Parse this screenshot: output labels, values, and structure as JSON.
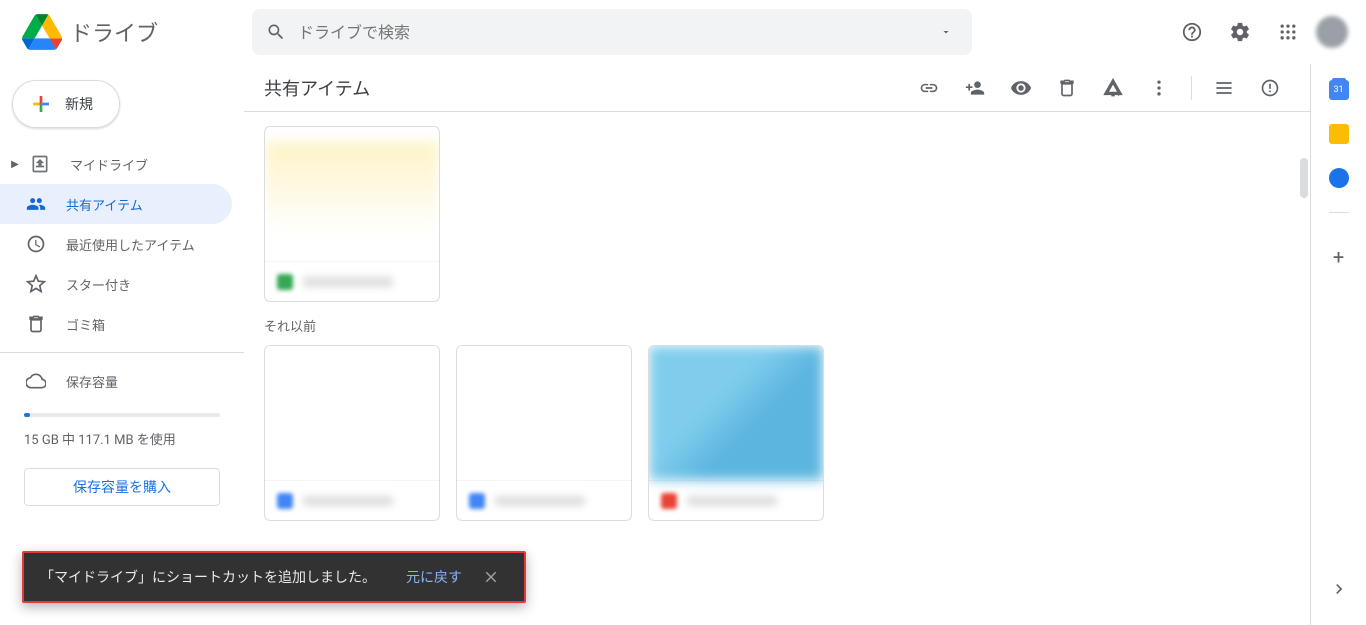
{
  "app_name": "ドライブ",
  "search": {
    "placeholder": "ドライブで検索"
  },
  "new_button": "新規",
  "nav": {
    "my_drive": "マイドライブ",
    "shared": "共有アイテム",
    "recent": "最近使用したアイテム",
    "starred": "スター付き",
    "trash": "ゴミ箱",
    "storage": "保存容量"
  },
  "storage_text": "15 GB 中 117.1 MB を使用",
  "buy_storage": "保存容量を購入",
  "page_title": "共有アイテム",
  "section_earlier": "それ以前",
  "calendar_day": "31",
  "toast": {
    "message": "「マイドライブ」にショートカットを追加しました。",
    "undo": "元に戻す"
  }
}
